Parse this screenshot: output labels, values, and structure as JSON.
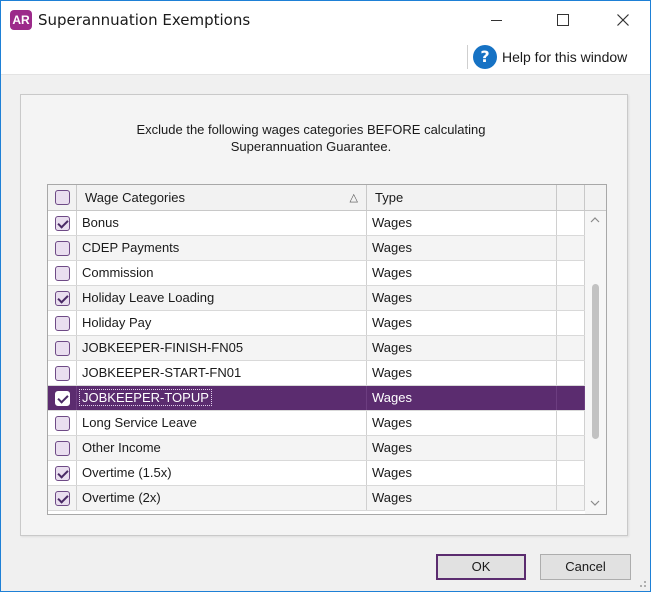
{
  "window": {
    "app_logo_text": "AR",
    "title": "Superannuation Exemptions"
  },
  "helpbar": {
    "label": "Help for this window",
    "icon_glyph": "?"
  },
  "instruction": {
    "line1": "Exclude the following wages categories BEFORE calculating",
    "line2": "Superannuation Guarantee."
  },
  "grid": {
    "columns": {
      "category": "Wage Categories",
      "type": "Type"
    },
    "sort_glyph": "△",
    "rows": [
      {
        "name": "Bonus",
        "type": "Wages",
        "checked": true
      },
      {
        "name": "CDEP Payments",
        "type": "Wages",
        "checked": false
      },
      {
        "name": "Commission",
        "type": "Wages",
        "checked": false
      },
      {
        "name": "Holiday Leave Loading",
        "type": "Wages",
        "checked": true
      },
      {
        "name": "Holiday Pay",
        "type": "Wages",
        "checked": false
      },
      {
        "name": "JOBKEEPER-FINISH-FN05",
        "type": "Wages",
        "checked": false
      },
      {
        "name": "JOBKEEPER-START-FN01",
        "type": "Wages",
        "checked": false
      },
      {
        "name": "JOBKEEPER-TOPUP",
        "type": "Wages",
        "checked": true,
        "selected": true
      },
      {
        "name": "Long Service Leave",
        "type": "Wages",
        "checked": false
      },
      {
        "name": "Other Income",
        "type": "Wages",
        "checked": false
      },
      {
        "name": "Overtime (1.5x)",
        "type": "Wages",
        "checked": true
      },
      {
        "name": "Overtime (2x)",
        "type": "Wages",
        "checked": true
      }
    ]
  },
  "buttons": {
    "ok": "OK",
    "cancel": "Cancel"
  },
  "colors": {
    "accent": "#5b2c6f",
    "logo": "#9c2a8a",
    "help": "#1672c4"
  }
}
